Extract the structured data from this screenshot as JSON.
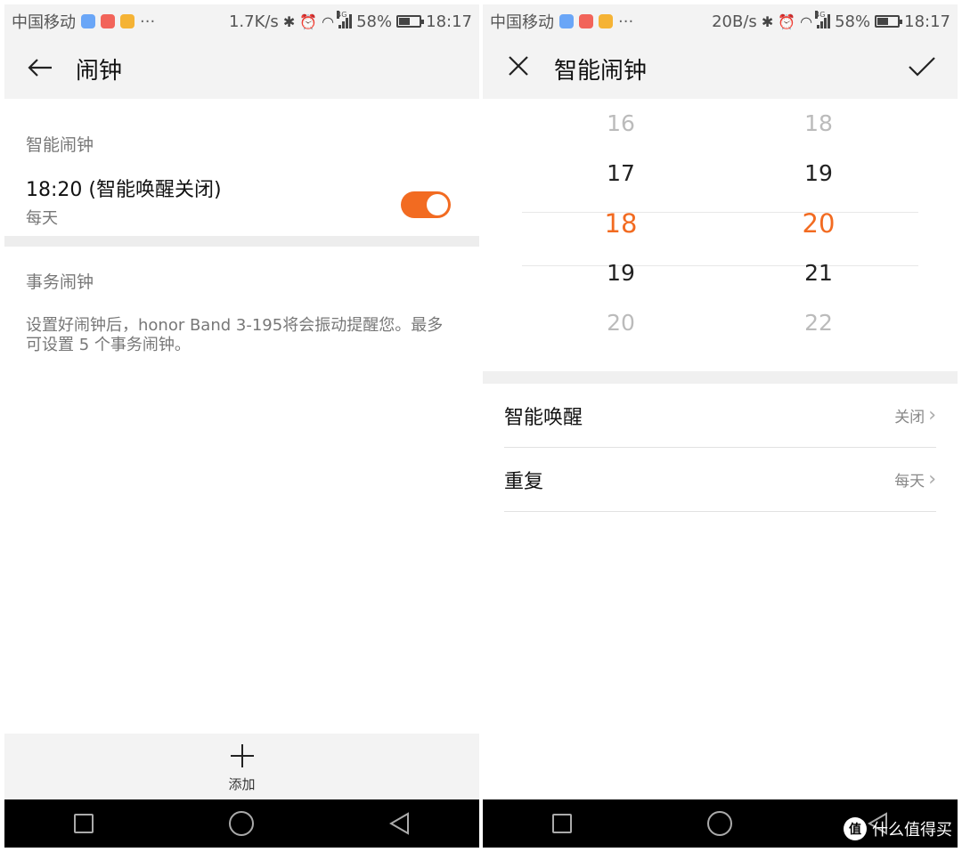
{
  "left": {
    "status": {
      "carrier": "中国移动",
      "more": "···",
      "speed": "1.7K/s",
      "battery": "58%",
      "time": "18:17",
      "network": "4G"
    },
    "header": {
      "title": "闹钟"
    },
    "smart_section": {
      "heading": "智能闹钟"
    },
    "alarm": {
      "time_label": "18:20 (智能唤醒关闭)",
      "repeat": "每天",
      "enabled": true
    },
    "event_section": {
      "heading": "事务闹钟",
      "info": "设置好闹钟后，honor Band 3-195将会振动提醒您。最多可设置 5 个事务闹钟。"
    },
    "add_bar": {
      "label": "添加"
    }
  },
  "right": {
    "status": {
      "carrier": "中国移动",
      "more": "···",
      "speed": "20B/s",
      "battery": "58%",
      "time": "18:17",
      "network": "4G"
    },
    "header": {
      "title": "智能闹钟"
    },
    "picker": {
      "hours": [
        "16",
        "17",
        "18",
        "19",
        "20"
      ],
      "minutes": [
        "18",
        "19",
        "20",
        "21",
        "22"
      ]
    },
    "settings": [
      {
        "label": "智能唤醒",
        "value": "关闭"
      },
      {
        "label": "重复",
        "value": "每天"
      }
    ],
    "watermark": {
      "badge": "值",
      "text": "什么值得买"
    }
  },
  "colors": {
    "accent": "#f26b21",
    "bar_bg": "#f3f3f3",
    "nav_bg": "#000000"
  },
  "icons": [
    "back-arrow-icon",
    "close-icon",
    "check-icon",
    "plus-icon",
    "bluetooth-icon",
    "alarm-icon",
    "wifi-icon",
    "signal-icon",
    "battery-icon",
    "chevron-right-icon",
    "recent-apps-icon",
    "home-icon",
    "back-nav-icon"
  ]
}
